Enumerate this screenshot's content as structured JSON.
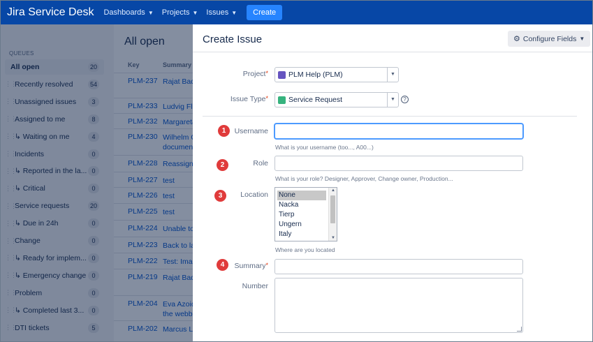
{
  "nav": {
    "logo": "Jira Service Desk",
    "items": [
      "Dashboards",
      "Projects",
      "Issues"
    ],
    "create": "Create"
  },
  "sidebar": {
    "heading": "QUEUES",
    "items": [
      {
        "label": "All open",
        "count": "20"
      },
      {
        "label": "Recently resolved",
        "count": "54"
      },
      {
        "label": "Unassigned issues",
        "count": "3"
      },
      {
        "label": "Assigned to me",
        "count": "8"
      },
      {
        "label": "↳ Waiting on me",
        "count": "4"
      },
      {
        "label": "Incidents",
        "count": "0"
      },
      {
        "label": "↳ Reported in the la...",
        "count": "0"
      },
      {
        "label": "↳ Critical",
        "count": "0"
      },
      {
        "label": "Service requests",
        "count": "20"
      },
      {
        "label": "↳ Due in 24h",
        "count": "0"
      },
      {
        "label": "Change",
        "count": "0"
      },
      {
        "label": "↳ Ready for implem...",
        "count": "0"
      },
      {
        "label": "↳ Emergency change",
        "count": "0"
      },
      {
        "label": "Problem",
        "count": "0"
      },
      {
        "label": "↳ Completed last 3...",
        "count": "0"
      },
      {
        "label": "DTI tickets",
        "count": "5"
      }
    ]
  },
  "main": {
    "title": "All open",
    "columns": {
      "key": "Key",
      "summary": "Summary"
    },
    "rows": [
      {
        "key": "PLM-237",
        "summary": "Rajat Bad"
      },
      {
        "key": "PLM-233",
        "summary": "Ludvig Flo"
      },
      {
        "key": "PLM-232",
        "summary": "Margareta"
      },
      {
        "key": "PLM-230",
        "summary": "Wilhelm C document"
      },
      {
        "key": "PLM-228",
        "summary": "Reassign"
      },
      {
        "key": "PLM-227",
        "summary": "test"
      },
      {
        "key": "PLM-226",
        "summary": "test"
      },
      {
        "key": "PLM-225",
        "summary": "test"
      },
      {
        "key": "PLM-224",
        "summary": "Unable to"
      },
      {
        "key": "PLM-223",
        "summary": "Back to la"
      },
      {
        "key": "PLM-222",
        "summary": "Test: Imag"
      },
      {
        "key": "PLM-219",
        "summary": "Rajat Bad"
      },
      {
        "key": "PLM-204",
        "summary": "Eva Azoid the webb"
      },
      {
        "key": "PLM-202",
        "summary": "Marcus Li"
      }
    ]
  },
  "modal": {
    "title": "Create Issue",
    "configure": "Configure Fields",
    "project": {
      "label": "Project",
      "value": "PLM Help (PLM)"
    },
    "issue_type": {
      "label": "Issue Type",
      "value": "Service Request"
    },
    "username": {
      "label": "Username",
      "hint": "What is your username (too..., A00...)",
      "marker": "1"
    },
    "role": {
      "label": "Role",
      "hint": "What is your role? Designer, Approver, Change owner, Production...",
      "marker": "2"
    },
    "location": {
      "label": "Location",
      "options": [
        "None",
        "Nacka",
        "Tierp",
        "Ungern",
        "Italy"
      ],
      "selected": "None",
      "hint": "Where are you located",
      "marker": "3"
    },
    "summary": {
      "label": "Summary",
      "marker": "4"
    },
    "number": {
      "label": "Number"
    }
  },
  "colors": {
    "nav": "#0747a6",
    "create": "#2684ff",
    "marker": "#e03b3b",
    "required": "#de350b"
  }
}
